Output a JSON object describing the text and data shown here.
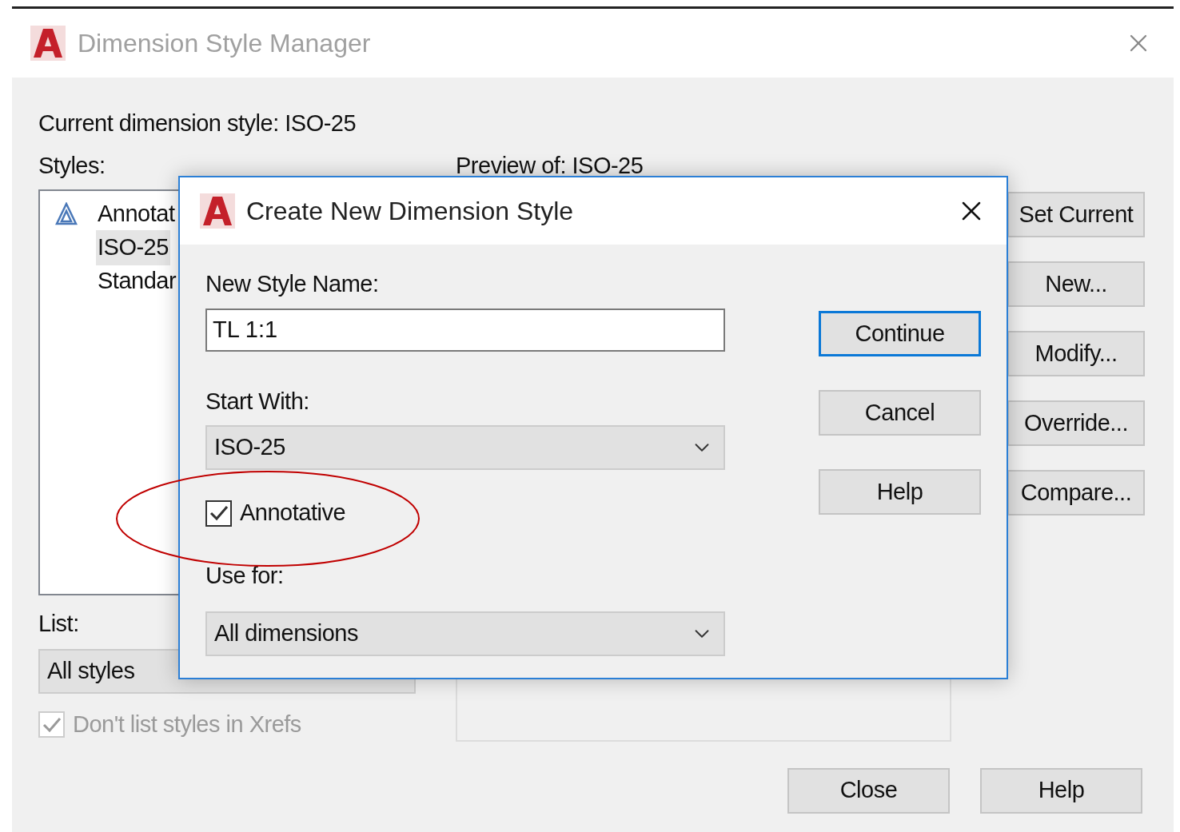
{
  "window": {
    "title": "Dimension Style Manager"
  },
  "current_style": "Current dimension style: ISO-25",
  "styles_label": "Styles:",
  "styles": [
    {
      "name": "Annotat",
      "annotative": true,
      "selected": false
    },
    {
      "name": "ISO-25",
      "annotative": false,
      "selected": true
    },
    {
      "name": "Standar",
      "annotative": false,
      "selected": false
    }
  ],
  "preview_label": "Preview of: ISO-25",
  "side_buttons": [
    "Set Current",
    "New...",
    "Modify...",
    "Override...",
    "Compare..."
  ],
  "list": {
    "label": "List:",
    "value": "All styles"
  },
  "xref_checkbox": {
    "label": "Don't list styles in Xrefs",
    "checked": true,
    "disabled": true
  },
  "buttons": [
    "Close",
    "Help"
  ],
  "dialog": {
    "title": "Create New Dimension Style",
    "name_label": "New Style Name:",
    "name_value": "TL 1:1",
    "start_label": "Start With:",
    "start_value": "ISO-25",
    "annotative": {
      "label": "Annotative",
      "checked": true
    },
    "use_label": "Use for:",
    "use_value": "All dimensions",
    "buttons": [
      {
        "label": "Continue",
        "default": true
      },
      {
        "label": "Cancel",
        "default": false
      },
      {
        "label": "Help",
        "default": false
      }
    ]
  }
}
